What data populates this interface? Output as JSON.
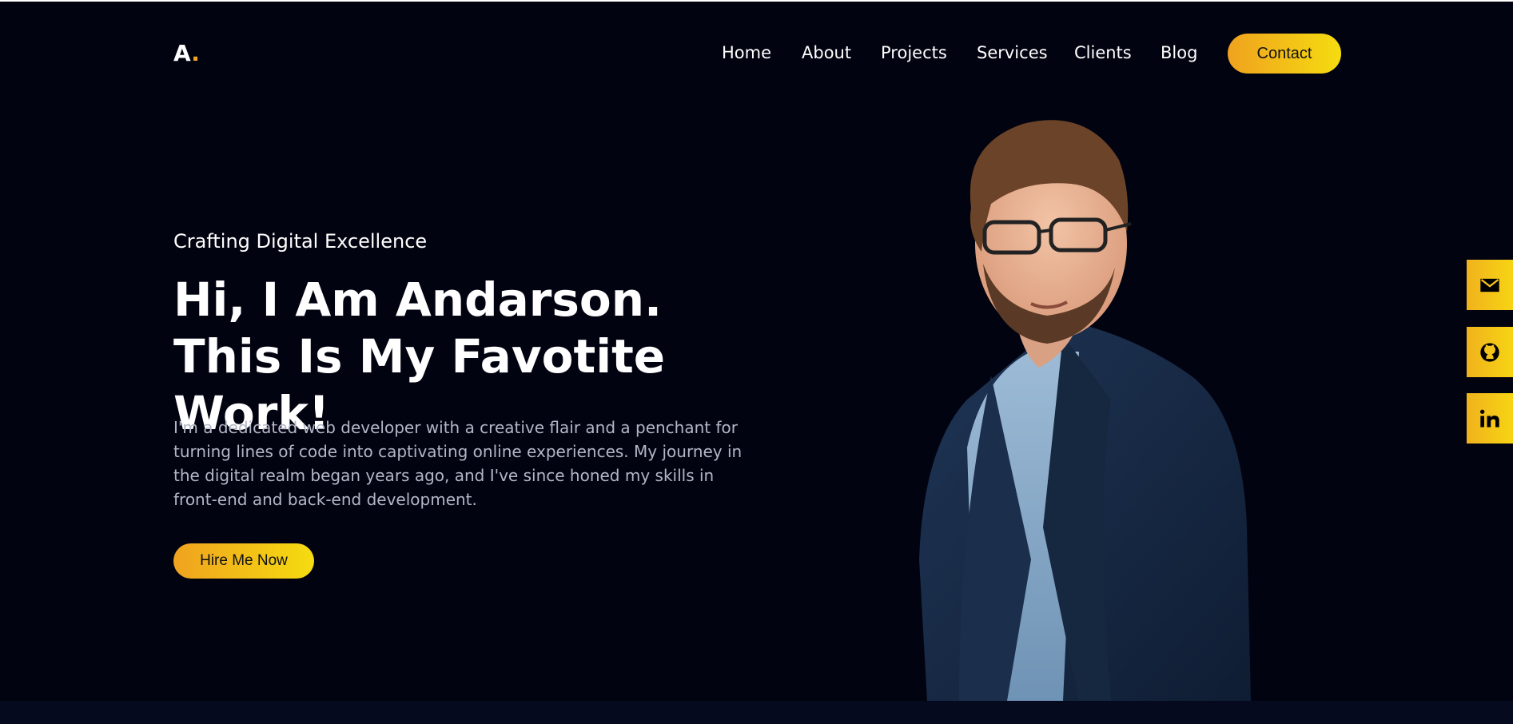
{
  "brand": {
    "logo_letter": "A",
    "logo_dot": "."
  },
  "nav": {
    "items": [
      "Home",
      "About",
      "Projects",
      "Services",
      "Clients",
      "Blog"
    ],
    "contact_label": "Contact"
  },
  "hero": {
    "subtitle": "Crafting Digital Excellence",
    "headline": "Hi, I Am Andarson. This Is My Favotite Work!",
    "intro": "I'm a dedicated web developer with a creative flair and a penchant for turning lines of code into captivating online experiences. My journey in the digital realm began years ago, and I've since honed my skills in front-end and back-end development.",
    "cta_label": "Hire Me Now"
  },
  "social": {
    "icons": [
      "mail-icon",
      "github-icon",
      "linkedin-icon"
    ]
  },
  "colors": {
    "background": "#020310",
    "accent_start": "#f0a21f",
    "accent_end": "#f5dc10",
    "muted_text": "#b3b6c6"
  }
}
